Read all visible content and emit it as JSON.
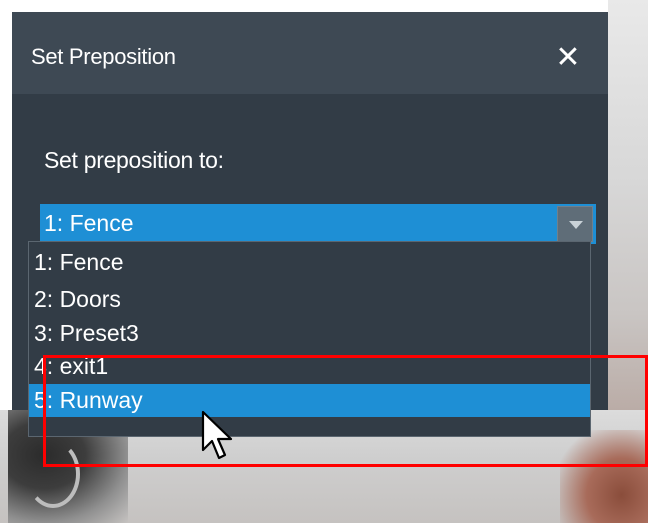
{
  "dialog": {
    "title": "Set Preposition",
    "close_glyph": "✕",
    "field_label": "Set preposition to:"
  },
  "select": {
    "value": "1: Fence",
    "arrow_icon": "chevron-down-icon"
  },
  "dropdown": {
    "options": [
      {
        "label": "1: Fence"
      },
      {
        "label": "2: Doors"
      },
      {
        "label": "3: Preset3"
      },
      {
        "label": "4: exit1"
      },
      {
        "label": "5: Runway",
        "highlighted": true
      }
    ]
  },
  "colors": {
    "dialog_body": "#323c46",
    "title_bar": "#3e4954",
    "accent": "#1e8fd5",
    "annotation": "#ff0000"
  },
  "icons": {
    "close": "close-icon",
    "cursor": "mouse-pointer-icon"
  }
}
